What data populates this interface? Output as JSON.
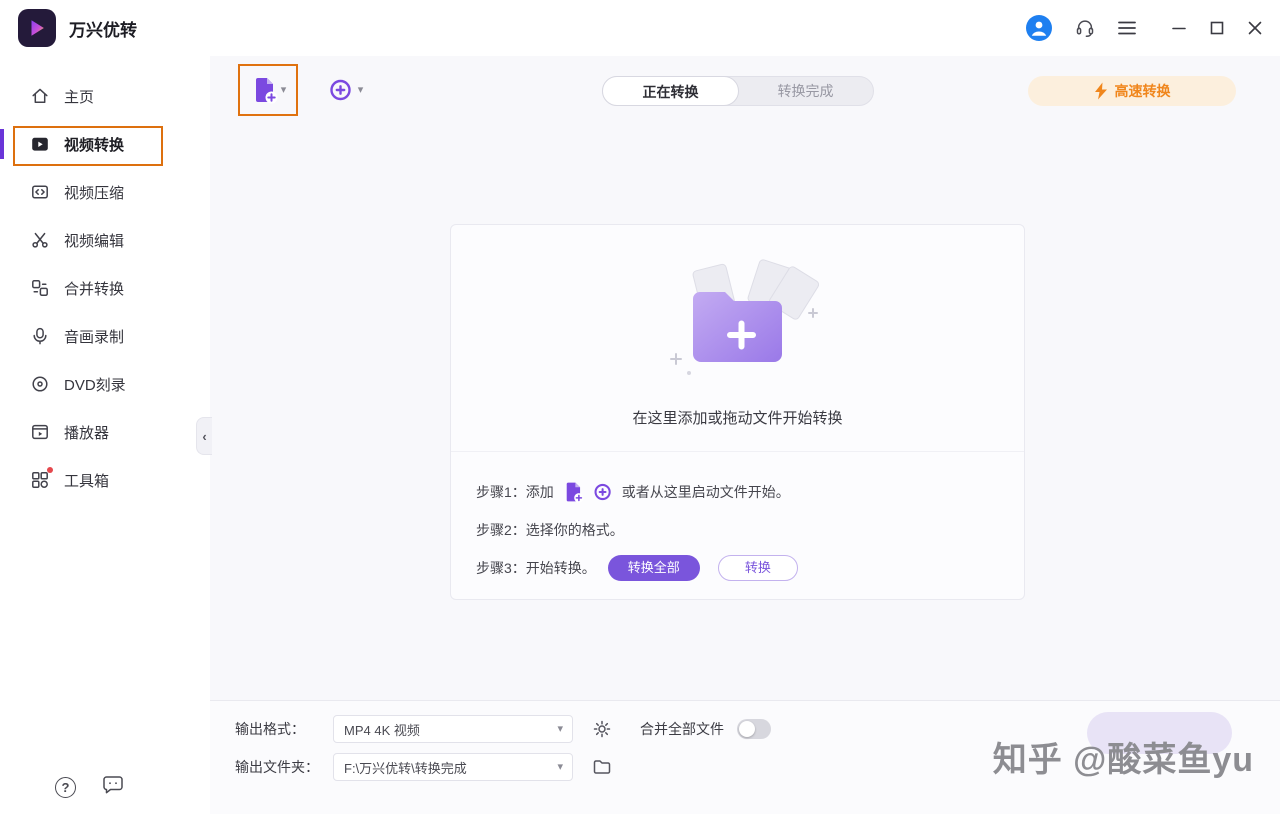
{
  "colors": {
    "accent_purple": "#7b49e0",
    "highlight_orange": "#dd700e",
    "speed_orange": "#f0861c",
    "avatar_blue": "#1e7ff0"
  },
  "titlebar": {
    "app_name": "万兴优转"
  },
  "sidebar": {
    "items": [
      {
        "label": "主页",
        "icon": "home-icon",
        "selected": false
      },
      {
        "label": "视频转换",
        "icon": "video-convert-icon",
        "selected": true
      },
      {
        "label": "视频压缩",
        "icon": "video-compress-icon",
        "selected": false
      },
      {
        "label": "视频编辑",
        "icon": "video-edit-icon",
        "selected": false
      },
      {
        "label": "合并转换",
        "icon": "merge-convert-icon",
        "selected": false
      },
      {
        "label": "音画录制",
        "icon": "record-icon",
        "selected": false
      },
      {
        "label": "DVD刻录",
        "icon": "dvd-icon",
        "selected": false
      },
      {
        "label": "播放器",
        "icon": "player-icon",
        "selected": false
      },
      {
        "label": "工具箱",
        "icon": "toolbox-icon",
        "selected": false
      }
    ]
  },
  "toolbar": {
    "tabs": [
      {
        "label": "正在转换",
        "active": true
      },
      {
        "label": "转换完成",
        "active": false
      }
    ],
    "speed_convert_label": "高速转换"
  },
  "dropzone": {
    "hint": "在这里添加或拖动文件开始转换"
  },
  "steps": {
    "step1_prefix": "步骤1：添加",
    "step1_suffix": "或者从这里启动文件开始。",
    "step2": "步骤2：选择你的格式。",
    "step3": "步骤3：开始转换。",
    "convert_all_label": "转换全部",
    "convert_label": "转换"
  },
  "footer": {
    "output_format_label": "输出格式：",
    "output_format_value": "MP4 4K 视频",
    "merge_all_label": "合并全部文件",
    "merge_all_on": false,
    "output_folder_label": "输出文件夹：",
    "output_folder_value": "F:\\万兴优转\\转换完成"
  },
  "watermark": "知乎 @酸菜鱼yu",
  "icons": {
    "chevron_down": "▾",
    "collapse_chevron": "‹",
    "help": "?"
  }
}
